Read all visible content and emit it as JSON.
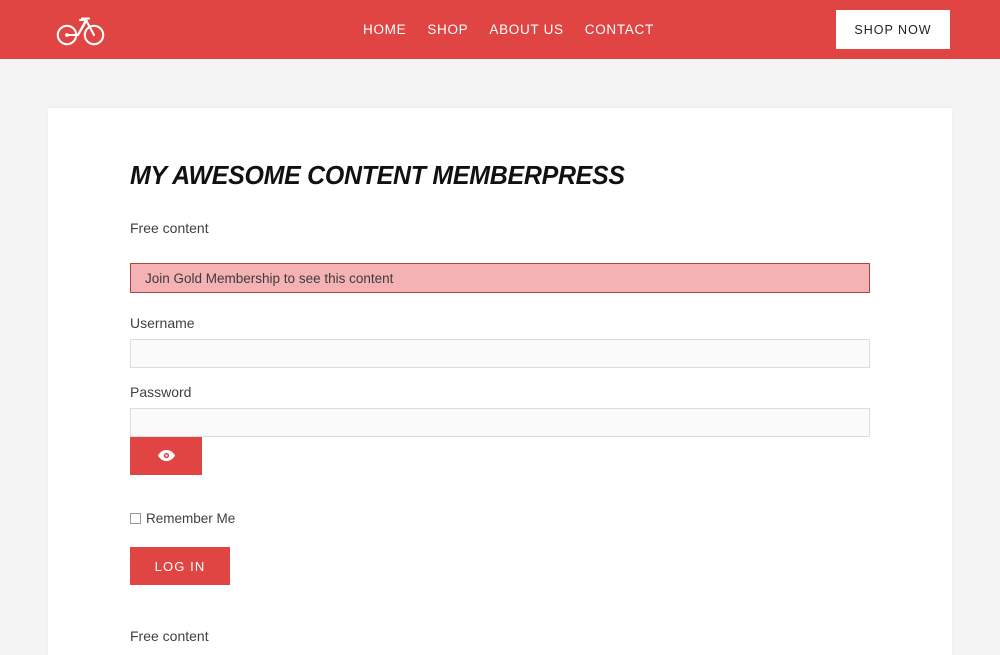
{
  "header": {
    "logo_icon": "bicycle-icon",
    "brand_color": "#e04543",
    "nav": [
      {
        "label": "HOME"
      },
      {
        "label": "SHOP"
      },
      {
        "label": "ABOUT US"
      },
      {
        "label": "CONTACT"
      }
    ],
    "cta": {
      "label": "SHOP NOW"
    }
  },
  "page": {
    "background_color": "#f4f4f4",
    "card_background": "#ffffff"
  },
  "main": {
    "title": "MY AWESOME CONTENT MEMBERPRESS",
    "free_content_top": "Free content",
    "free_content_bottom": "Free content",
    "alert": {
      "message": "Join Gold Membership to see this content",
      "background_color": "#f5b2b5",
      "border_color": "#a94442"
    },
    "form": {
      "username": {
        "label": "Username",
        "value": "",
        "placeholder": ""
      },
      "password": {
        "label": "Password",
        "value": "",
        "placeholder": ""
      },
      "toggle_password_icon": "eye-icon",
      "remember": {
        "label": "Remember Me",
        "checked": false
      },
      "submit": {
        "label": "LOG IN"
      }
    }
  }
}
